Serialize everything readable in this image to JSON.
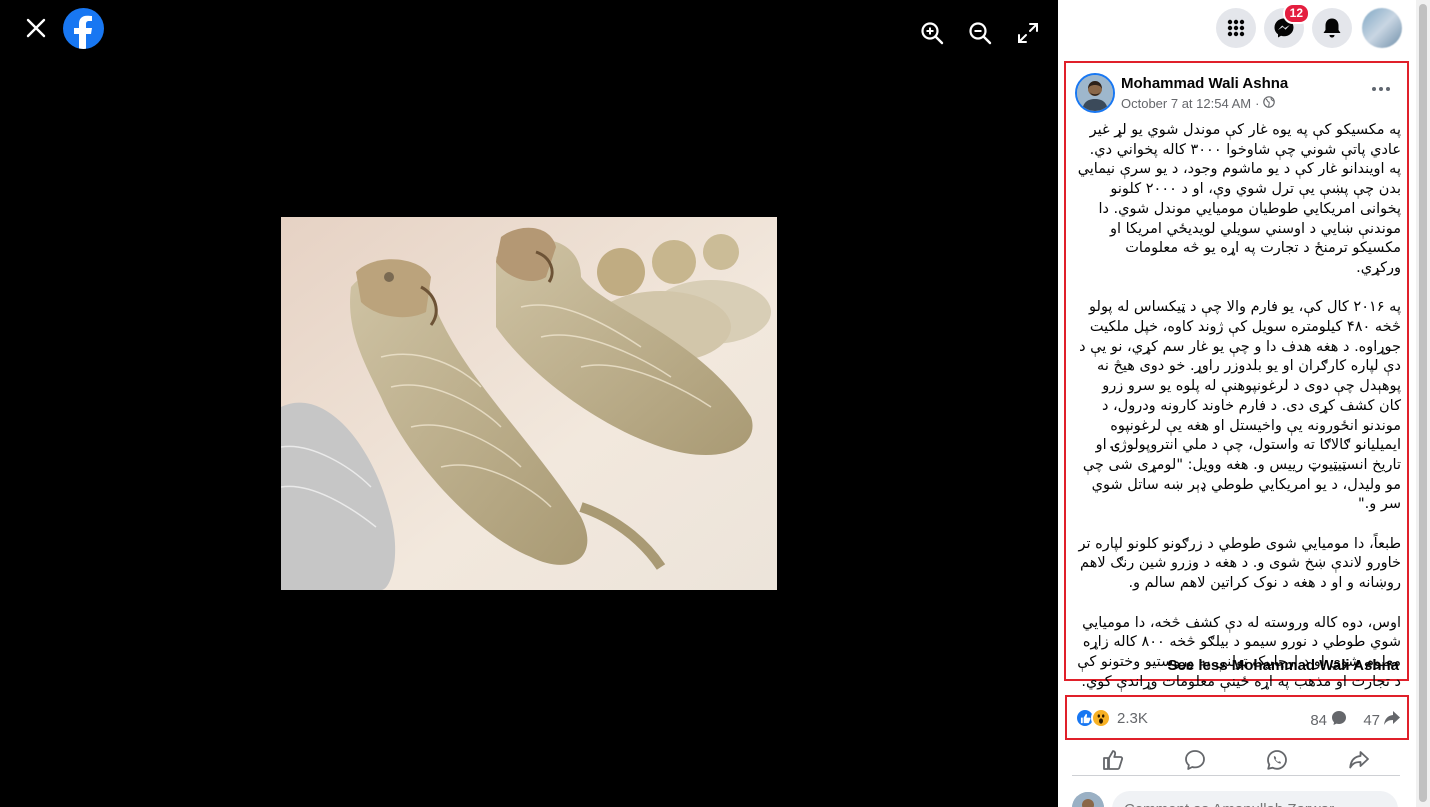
{
  "viewer": {
    "close_icon": "close-icon",
    "logo_icon": "facebook-logo",
    "tools": [
      "zoom-in-icon",
      "zoom-out-icon",
      "fullscreen-icon"
    ],
    "background": "#000000"
  },
  "topbar": {
    "menu_icon": "grid-menu-icon",
    "messenger_icon": "messenger-icon",
    "messenger_badge": "12",
    "notifications_icon": "bell-icon"
  },
  "post": {
    "author": "Mohammad Wali Ashna",
    "timestamp": "October 7 at 12:54 AM",
    "separator": "·",
    "paragraphs": [
      "په مکسیکو کې په یوه غار کې موندل شوي یو لړ غیر عادي پاتې شوني چې شاوخوا ۳۰۰۰ کاله پخواني دي. په اویندانو غار کې د یو ماشوم وجود، د یو سرې نیمایي بدن چې پښې یې ترل شوي وې، او د ۲۰۰۰ کلونو پخوانی امریکایي طوطیان مومیایي موندل شوي. دا موندنې ښايي د اوسني سویلي لویدیځي امریکا او مکسیکو ترمنځ د تجارت په اړه یو څه معلومات ورکړي.",
      "په ۲۰۱۶ کال کې، یو فارم والا چې د ټیکساس له پولو څخه ۴۸۰ کیلومتره سویل کې ژوند کاوه، خپل ملکیت جوړاوه. د هغه هدف دا و چې یو غار سم کړي، نو یې د دې لپاره کارګران او یو بلدوزر راوړ. خو دوی هیڅ نه پوهېدل چې دوی د لرغونپوهنې له پلوه یو سرو زرو کان کشف کړی دی. د فارم خاوند کارونه ودرول، د موندنو انځورونه یې واخیستل او هغه یې لرغونپوه ایمیلیانو ګالاګا ته واستول، چې د ملي انتروپولوژۍ او تاریخ انسټیټیوټ رییس و. هغه وویل: \"لومړی شی چې مو ولیدل، د یو امریکایي طوطي ډېر ښه ساتل شوي سر و.\"",
      "طبعاً، دا مومیایي شوی طوطي د زرګونو کلونو لپاره تر خاورو لاندې ښخ شوی و. د هغه د وزرو شین رنګ لاهم روښانه و او د هغه د نوک کراتین لاهم سالم و.",
      "اوس، دوه کاله وروسته له دې کشف څخه، دا مومیایي شوي طوطي د نورو سیمو د بیلګو څخه ۸۰۰ کاله زاړه معلوم شوي او د ارچاییک ټولنې په وروستیو وختونو کې د تجارت او مذهب په اړه ځینې معلومات وړاندې کوي."
    ],
    "see_less": "See less Mohammad Wali Ashna"
  },
  "stats": {
    "reactions_count": "2.3K",
    "comments_count": "84",
    "shares_count": "47",
    "reaction_icons": [
      "like-icon",
      "wow-icon"
    ]
  },
  "actions": [
    "like-icon",
    "comment-icon",
    "whatsapp-icon",
    "share-icon"
  ],
  "comment": {
    "placeholder": "Comment as Amanullah Zarwar"
  },
  "colors": {
    "accent": "#1877f2",
    "badge": "#e41e3f",
    "highlight_border": "#e0202a"
  }
}
